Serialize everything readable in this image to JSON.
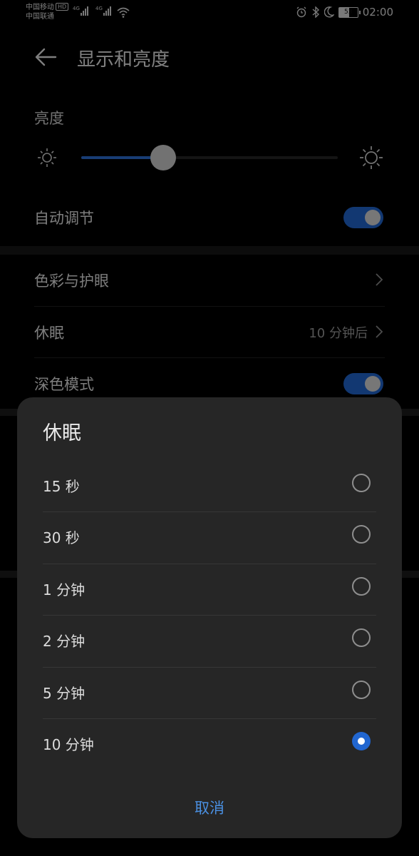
{
  "status_bar": {
    "carrier1": "中国移动",
    "hd": "HD",
    "carrier2": "中国联通",
    "net1": "4G",
    "net2": "4G",
    "battery": "53",
    "time": "02:00"
  },
  "header": {
    "title": "显示和亮度"
  },
  "brightness": {
    "label": "亮度",
    "level_percent": 32
  },
  "auto_adjust": {
    "label": "自动调节",
    "on": true
  },
  "color_eye": {
    "label": "色彩与护眼"
  },
  "sleep": {
    "label": "休眠",
    "value": "10 分钟后"
  },
  "dark_mode": {
    "label": "深色模式",
    "on": true
  },
  "dialog": {
    "title": "休眠",
    "options": [
      {
        "label": "15 秒",
        "selected": false
      },
      {
        "label": "30 秒",
        "selected": false
      },
      {
        "label": "1 分钟",
        "selected": false
      },
      {
        "label": "2 分钟",
        "selected": false
      },
      {
        "label": "5 分钟",
        "selected": false
      },
      {
        "label": "10 分钟",
        "selected": true
      }
    ],
    "cancel": "取消"
  },
  "colors": {
    "accent": "#2166d0",
    "link": "#4a90e2"
  }
}
